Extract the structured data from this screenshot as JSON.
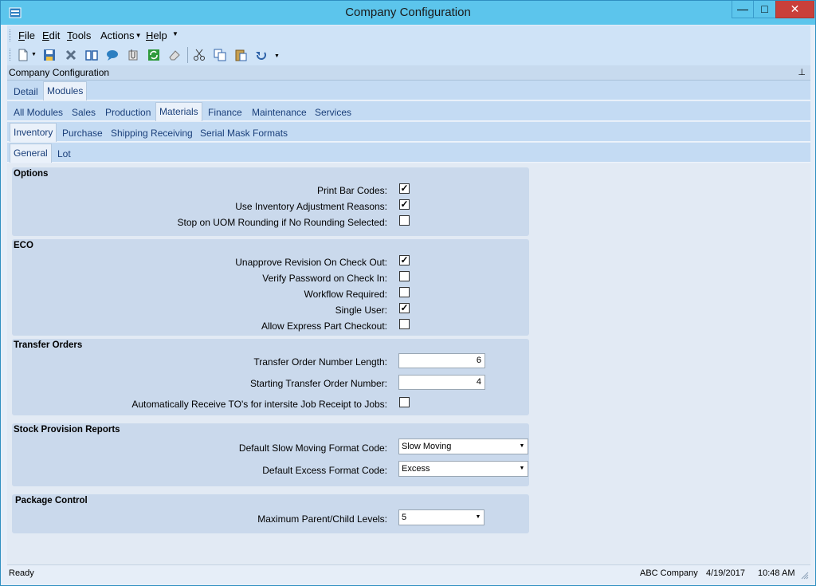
{
  "window": {
    "title": "Company Configuration",
    "controls": {
      "minimize": "—",
      "maximize": "□",
      "close": "✕"
    }
  },
  "menu": {
    "file": {
      "prefix": "",
      "accel": "F",
      "rest": "ile"
    },
    "edit": {
      "accel": "E",
      "rest": "dit"
    },
    "tools": {
      "accel": "T",
      "rest": "ools"
    },
    "actions": "Actions",
    "help": {
      "accel": "H",
      "rest": "elp"
    }
  },
  "toolbar": {
    "icons": [
      "new-icon",
      "save-icon",
      "delete-icon",
      "book-icon",
      "chat-icon",
      "attach-icon",
      "refresh-icon",
      "eraser-icon",
      "cut-icon",
      "copy-icon",
      "paste-icon",
      "undo-icon"
    ]
  },
  "pane": {
    "header": "Company Configuration"
  },
  "tabs": {
    "level1": [
      "Detail",
      "Modules"
    ],
    "level2": [
      "All Modules",
      "Sales",
      "Production",
      "Materials",
      "Finance",
      "Maintenance",
      "Services"
    ],
    "level3": [
      "Inventory",
      "Purchase",
      "Shipping Receiving",
      "Serial Mask Formats"
    ],
    "level4": [
      "General",
      "Lot"
    ]
  },
  "options": {
    "title": "Options",
    "print_bar_codes": {
      "label": "Print Bar Codes:",
      "checked": true
    },
    "use_inventory_adjustment_reasons": {
      "label": "Use Inventory Adjustment Reasons:",
      "checked": true
    },
    "stop_on_uom_rounding": {
      "label": "Stop on UOM Rounding if No Rounding Selected:",
      "checked": false
    }
  },
  "eco": {
    "title": "ECO",
    "unapprove_revision": {
      "label": "Unapprove Revision On Check Out:",
      "checked": true
    },
    "verify_password": {
      "label": "Verify Password on Check In:",
      "checked": false
    },
    "workflow_required": {
      "label": "Workflow Required:",
      "checked": false
    },
    "single_user": {
      "label": "Single User:",
      "checked": true
    },
    "allow_express_part_checkout": {
      "label": "Allow Express Part Checkout:",
      "checked": false
    }
  },
  "transfer_orders": {
    "title": "Transfer Orders",
    "number_length": {
      "label": "Transfer Order Number Length:",
      "value": "6"
    },
    "starting_number": {
      "label": "Starting Transfer Order Number:",
      "value": "4"
    },
    "auto_receive": {
      "label": "Automatically Receive TO's for intersite Job Receipt to Jobs:",
      "checked": false
    }
  },
  "stock_provision": {
    "title": "Stock Provision Reports",
    "slow_moving": {
      "label": "Default Slow Moving Format Code:",
      "value": "Slow Moving"
    },
    "excess": {
      "label": "Default Excess Format Code:",
      "value": "Excess"
    }
  },
  "package_control": {
    "title": "Package Control",
    "max_levels": {
      "label": "Maximum Parent/Child Levels:",
      "value": "5"
    }
  },
  "status": {
    "state": "Ready",
    "company": "ABC Company",
    "date": "4/19/2017",
    "time": "10:48 AM"
  },
  "colors": {
    "titlebar": "#5cc5ec",
    "close_button": "#c9403a",
    "tab_text": "#1a3f7a",
    "group_bg": "#cad9ec"
  }
}
